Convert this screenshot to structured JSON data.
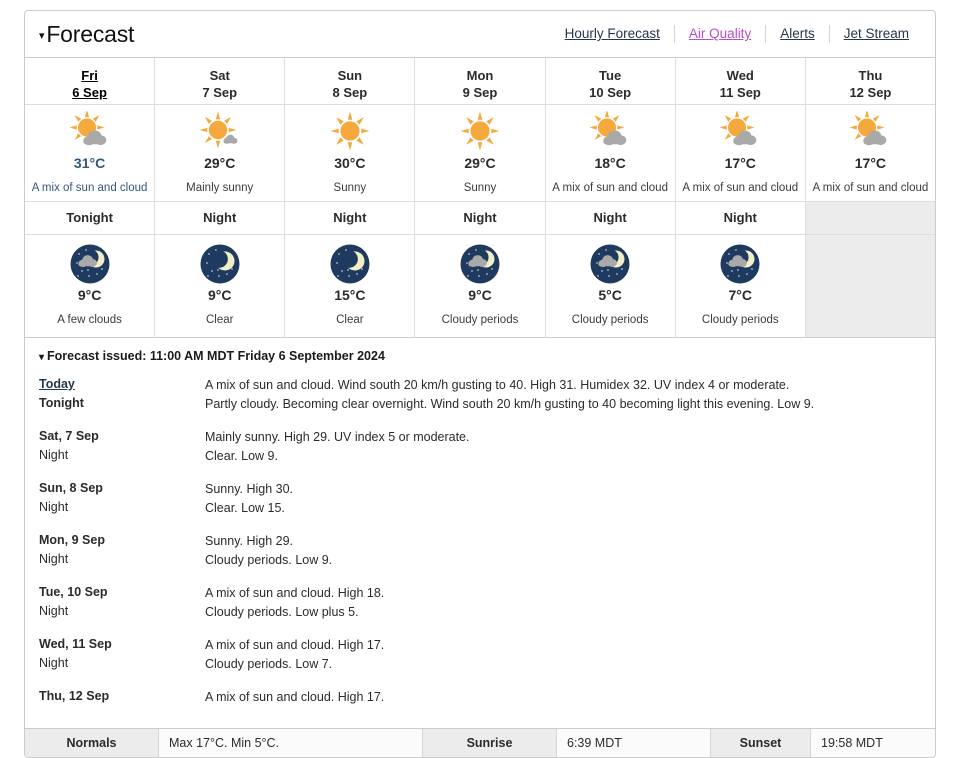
{
  "header": {
    "title": "Forecast",
    "caret": "▾",
    "links": [
      {
        "label": "Hourly Forecast",
        "visited": false
      },
      {
        "label": "Air Quality",
        "visited": true
      },
      {
        "label": "Alerts",
        "visited": false
      },
      {
        "label": "Jet Stream",
        "visited": false
      }
    ]
  },
  "columns": [
    {
      "day_name": "Fri",
      "day_date": "6 Sep",
      "today": true,
      "day_icon": "sun-cloud-icon",
      "day_temp": "31°C",
      "day_cond": "A mix of sun and cloud",
      "night_label": "Tonight",
      "night_icon": "moon-cloud-icon",
      "night_temp": "9°C",
      "night_cond": "A few clouds",
      "night_empty": false
    },
    {
      "day_name": "Sat",
      "day_date": "7 Sep",
      "today": false,
      "day_icon": "sun-small-cloud-icon",
      "day_temp": "29°C",
      "day_cond": "Mainly sunny",
      "night_label": "Night",
      "night_icon": "moon-clear-icon",
      "night_temp": "9°C",
      "night_cond": "Clear",
      "night_empty": false
    },
    {
      "day_name": "Sun",
      "day_date": "8 Sep",
      "today": false,
      "day_icon": "sun-icon",
      "day_temp": "30°C",
      "day_cond": "Sunny",
      "night_label": "Night",
      "night_icon": "moon-clear-icon",
      "night_temp": "15°C",
      "night_cond": "Clear",
      "night_empty": false
    },
    {
      "day_name": "Mon",
      "day_date": "9 Sep",
      "today": false,
      "day_icon": "sun-icon",
      "day_temp": "29°C",
      "day_cond": "Sunny",
      "night_label": "Night",
      "night_icon": "moon-cloud-icon",
      "night_temp": "9°C",
      "night_cond": "Cloudy periods",
      "night_empty": false
    },
    {
      "day_name": "Tue",
      "day_date": "10 Sep",
      "today": false,
      "day_icon": "sun-cloud-icon",
      "day_temp": "18°C",
      "day_cond": "A mix of sun and cloud",
      "night_label": "Night",
      "night_icon": "moon-cloud-icon",
      "night_temp": "5°C",
      "night_cond": "Cloudy periods",
      "night_empty": false
    },
    {
      "day_name": "Wed",
      "day_date": "11 Sep",
      "today": false,
      "day_icon": "sun-cloud-icon",
      "day_temp": "17°C",
      "day_cond": "A mix of sun and cloud",
      "night_label": "Night",
      "night_icon": "moon-cloud-icon",
      "night_temp": "7°C",
      "night_cond": "Cloudy periods",
      "night_empty": false
    },
    {
      "day_name": "Thu",
      "day_date": "12 Sep",
      "today": false,
      "day_icon": "sun-cloud-icon",
      "day_temp": "17°C",
      "day_cond": "A mix of sun and cloud",
      "night_label": "",
      "night_icon": "",
      "night_temp": "",
      "night_cond": "",
      "night_empty": true
    }
  ],
  "details": {
    "caret": "▾",
    "issued": "Forecast issued: 11:00 AM MDT Friday 6 September 2024",
    "entries": [
      {
        "day_label": "Today",
        "day_is_link": true,
        "day_text": "A mix of sun and cloud. Wind south 20 km/h gusting to 40. High 31. Humidex 32. UV index 4 or moderate.",
        "night_label": "Tonight",
        "night_text": "Partly cloudy. Becoming clear overnight. Wind south 20 km/h gusting to 40 becoming light this evening. Low 9."
      },
      {
        "day_label": "Sat, 7 Sep",
        "day_is_link": false,
        "day_text": "Mainly sunny. High 29. UV index 5 or moderate.",
        "night_label": "Night",
        "night_text": "Clear. Low 9."
      },
      {
        "day_label": "Sun, 8 Sep",
        "day_is_link": false,
        "day_text": "Sunny. High 30.",
        "night_label": "Night",
        "night_text": "Clear. Low 15."
      },
      {
        "day_label": "Mon, 9 Sep",
        "day_is_link": false,
        "day_text": "Sunny. High 29.",
        "night_label": "Night",
        "night_text": "Cloudy periods. Low 9."
      },
      {
        "day_label": "Tue, 10 Sep",
        "day_is_link": false,
        "day_text": "A mix of sun and cloud. High 18.",
        "night_label": "Night",
        "night_text": "Cloudy periods. Low plus 5."
      },
      {
        "day_label": "Wed, 11 Sep",
        "day_is_link": false,
        "day_text": "A mix of sun and cloud. High 17.",
        "night_label": "Night",
        "night_text": "Cloudy periods. Low 7."
      },
      {
        "day_label": "Thu, 12 Sep",
        "day_is_link": false,
        "day_text": "A mix of sun and cloud. High 17.",
        "night_label": "",
        "night_text": ""
      }
    ]
  },
  "normals": {
    "normals_label": "Normals",
    "normals_value": "Max 17°C. Min 5°C.",
    "sunrise_label": "Sunrise",
    "sunrise_value": "6:39 MDT",
    "sunset_label": "Sunset",
    "sunset_value": "19:58 MDT"
  },
  "colors": {
    "sun": "#f5a93c",
    "cloud": "#a9a9a9",
    "night_sky": "#1f3a5f",
    "moon": "#f2efc8",
    "link": "#26374a",
    "visited_link": "#b64ed1"
  }
}
